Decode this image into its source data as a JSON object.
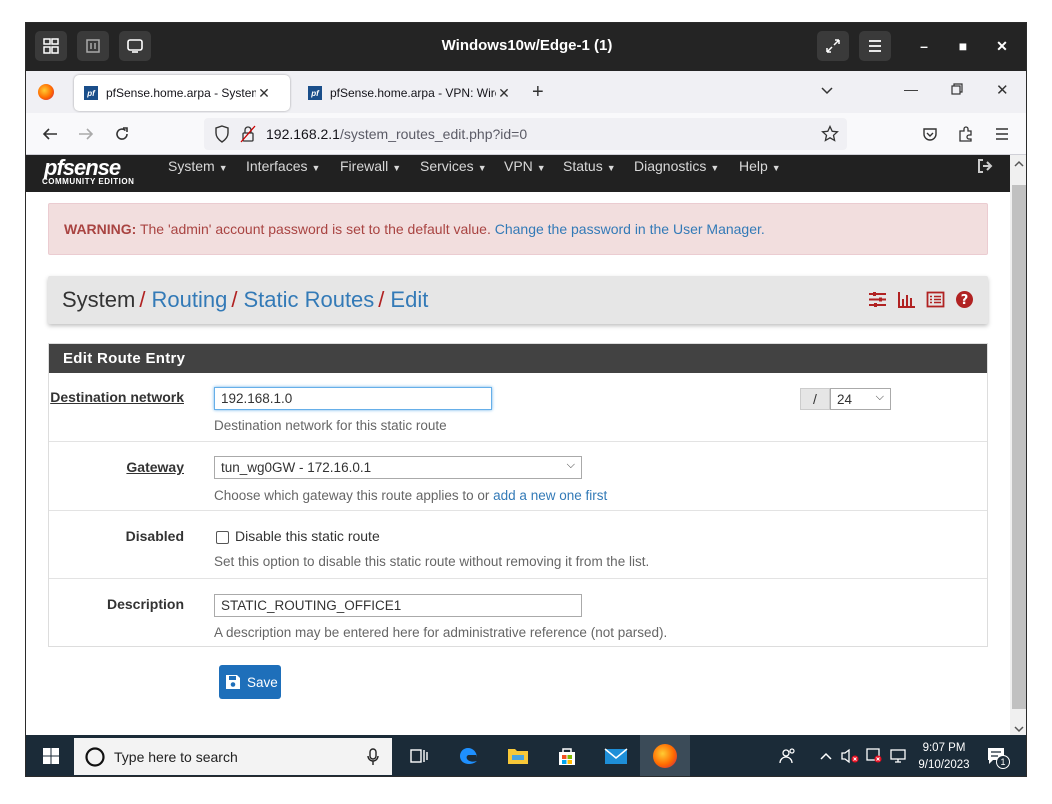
{
  "vm": {
    "title": "Windows10w/Edge-1 (1)"
  },
  "browser": {
    "tabs": [
      {
        "label": "pfSense.home.arpa - System: Routing: Static Routes: Edit",
        "active": true
      },
      {
        "label": "pfSense.home.arpa - VPN: WireGuard",
        "active": false
      }
    ],
    "new_tab": "+",
    "url_host": "192.168.2.1",
    "url_path": "/system_routes_edit.php?id=0"
  },
  "pfsense": {
    "logo_word": "pfsense",
    "logo_edition": "COMMUNITY EDITION",
    "menu": [
      "System",
      "Interfaces",
      "Firewall",
      "Services",
      "VPN",
      "Status",
      "Diagnostics",
      "Help"
    ],
    "warning_label": "WARNING:",
    "warning_text": " The 'admin' account password is set to the default value. ",
    "warning_link": "Change the password in the User Manager.",
    "breadcrumb": {
      "system": "System",
      "routing": "Routing",
      "static_routes": "Static Routes",
      "edit": "Edit",
      "sep": "/"
    },
    "panel_title": "Edit Route Entry",
    "fields": {
      "destination": {
        "label": "Destination network",
        "value": "192.168.1.0",
        "slash": "/",
        "mask": "24",
        "help": "Destination network for this static route"
      },
      "gateway": {
        "label": "Gateway",
        "value": "tun_wg0GW - 172.16.0.1",
        "help": "Choose which gateway this route applies to or ",
        "help_link": "add a new one first"
      },
      "disabled": {
        "label": "Disabled",
        "checkbox_label": "Disable this static route",
        "checked": false,
        "help": "Set this option to disable this static route without removing it from the list."
      },
      "description": {
        "label": "Description",
        "value": "STATIC_ROUTING_OFFICE1",
        "help": "A description may be entered here for administrative reference (not parsed)."
      }
    },
    "save_label": "Save",
    "accent": "#337ab7",
    "header_bg": "#212121"
  },
  "taskbar": {
    "search_placeholder": "Type here to search",
    "time": "9:07 PM",
    "date": "9/10/2023",
    "notification_count": "1"
  }
}
